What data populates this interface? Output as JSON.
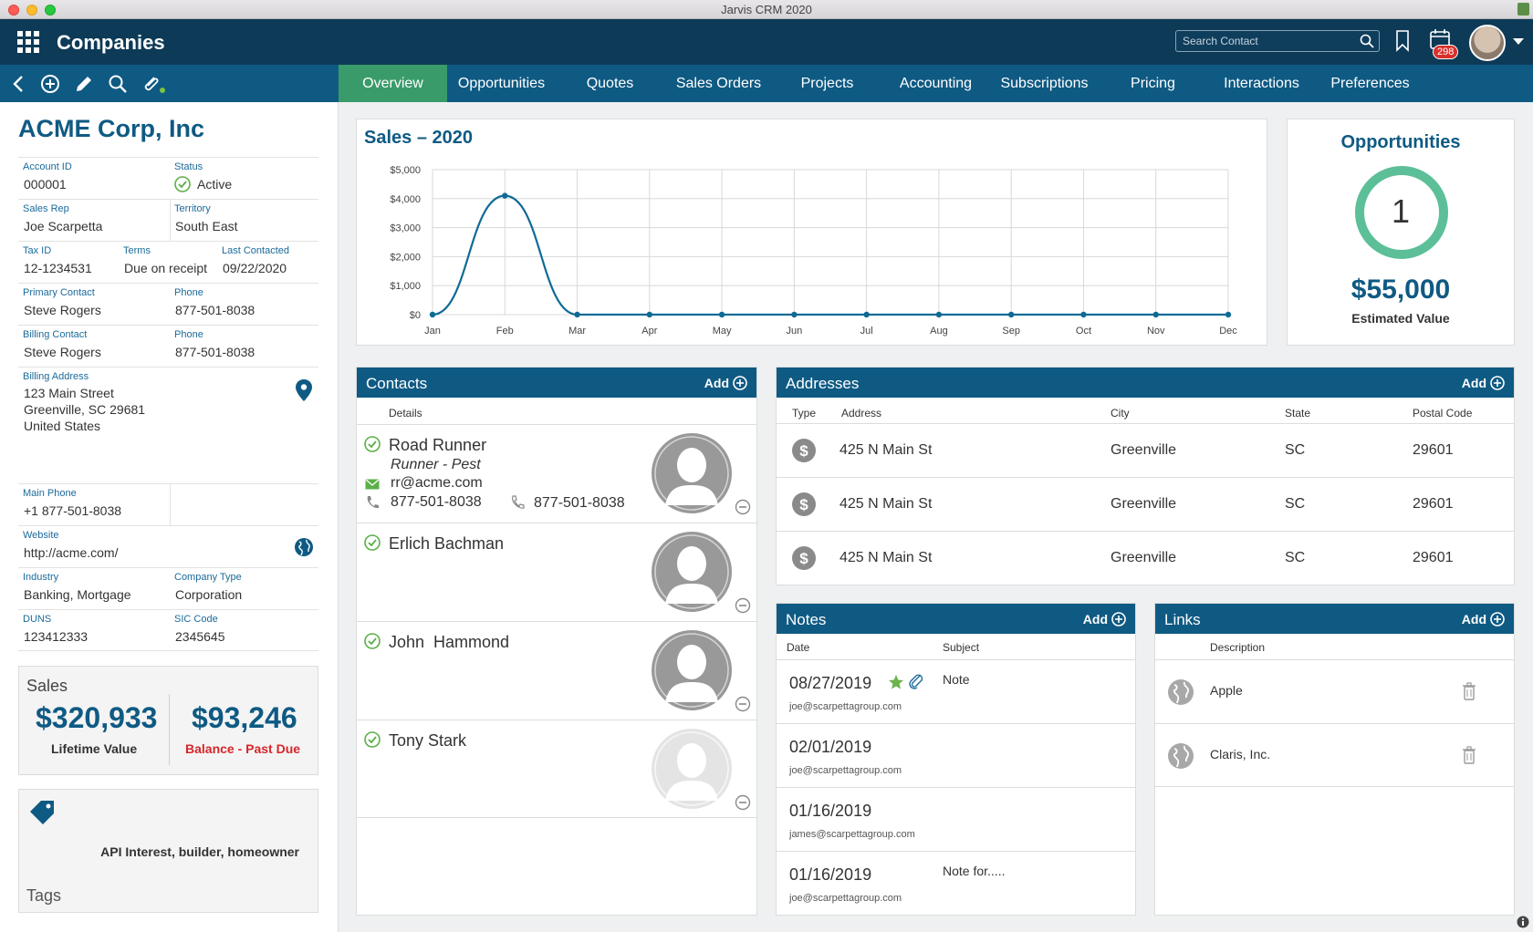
{
  "window": {
    "title": "Jarvis CRM 2020"
  },
  "header": {
    "title": "Companies",
    "search_placeholder": "Search Contact",
    "notification_count": "298"
  },
  "tabs": [
    "Overview",
    "Opportunities",
    "Quotes",
    "Sales Orders",
    "Projects",
    "Accounting",
    "Subscriptions",
    "Pricing",
    "Interactions",
    "Preferences"
  ],
  "company": {
    "name": "ACME Corp, Inc",
    "account_id_label": "Account ID",
    "account_id": "000001",
    "status_label": "Status",
    "status": "Active",
    "sales_rep_label": "Sales Rep",
    "sales_rep": "Joe Scarpetta",
    "territory_label": "Territory",
    "territory": "South East",
    "tax_id_label": "Tax ID",
    "tax_id": "12-1234531",
    "terms_label": "Terms",
    "terms": "Due on receipt",
    "last_contacted_label": "Last Contacted",
    "last_contacted": "09/22/2020",
    "primary_contact_label": "Primary Contact",
    "primary_contact": "Steve Rogers",
    "phone_label": "Phone",
    "primary_phone": "877-501-8038",
    "billing_contact_label": "Billing Contact",
    "billing_contact": "Steve Rogers",
    "billing_phone": "877-501-8038",
    "billing_address_label": "Billing Address",
    "address_line1": "123 Main Street",
    "address_line2": "Greenville, SC 29681",
    "address_line3": "United States",
    "main_phone_label": "Main Phone",
    "main_phone": "+1 877-501-8038",
    "website_label": "Website",
    "website": "http://acme.com/",
    "industry_label": "Industry",
    "industry": "Banking, Mortgage",
    "company_type_label": "Company Type",
    "company_type": "Corporation",
    "duns_label": "DUNS",
    "duns": "123412333",
    "sic_label": "SIC Code",
    "sic": "2345645"
  },
  "sales": {
    "title": "Sales",
    "lifetime_value": "$320,933",
    "lifetime_label": "Lifetime Value",
    "balance": "$93,246",
    "balance_label": "Balance - Past Due"
  },
  "tags": {
    "title": "Tags",
    "text": "API Interest, builder, homeowner"
  },
  "chart_data": {
    "type": "line",
    "title": "Sales – 2020",
    "categories": [
      "Jan",
      "Feb",
      "Mar",
      "Apr",
      "May",
      "Jun",
      "Jul",
      "Aug",
      "Sep",
      "Oct",
      "Nov",
      "Dec"
    ],
    "values": [
      0,
      4100,
      0,
      0,
      0,
      0,
      0,
      0,
      0,
      0,
      0,
      0
    ],
    "yticks": [
      "$0",
      "$1,000",
      "$2,000",
      "$3,000",
      "$4,000",
      "$5,000"
    ],
    "ylim": [
      0,
      5000
    ],
    "grid": true,
    "color": "#0f6a96"
  },
  "opportunities": {
    "title": "Opportunities",
    "count": "1",
    "value": "$55,000",
    "value_label": "Estimated Value",
    "ring_color": "#5cbf98"
  },
  "contacts": {
    "title": "Contacts",
    "add_label": "Add",
    "details_label": "Details",
    "items": [
      {
        "name": "Road Runner",
        "role": "Runner - Pest",
        "email": "rr@acme.com",
        "phone1": "877-501-8038",
        "phone2": "877-501-8038"
      },
      {
        "name": "Erlich Bachman"
      },
      {
        "name": "John  Hammond"
      },
      {
        "name": "Tony Stark"
      }
    ]
  },
  "addresses": {
    "title": "Addresses",
    "add_label": "Add",
    "columns": [
      "Type",
      "Address",
      "City",
      "State",
      "Postal Code"
    ],
    "rows": [
      {
        "address": "425 N Main St",
        "city": "Greenville",
        "state": "SC",
        "postal": "29601"
      },
      {
        "address": "425 N Main St",
        "city": "Greenville",
        "state": "SC",
        "postal": "29601"
      },
      {
        "address": "425 N Main St",
        "city": "Greenville",
        "state": "SC",
        "postal": "29601"
      }
    ]
  },
  "notes": {
    "title": "Notes",
    "add_label": "Add",
    "columns": [
      "Date",
      "Subject"
    ],
    "rows": [
      {
        "date": "08/27/2019",
        "email": "joe@scarpettagroup.com",
        "subject": "Note"
      },
      {
        "date": "02/01/2019",
        "email": "joe@scarpettagroup.com",
        "subject": ""
      },
      {
        "date": "01/16/2019",
        "email": "james@scarpettagroup.com",
        "subject": ""
      },
      {
        "date": "01/16/2019",
        "email": "joe@scarpettagroup.com",
        "subject": "Note for....."
      }
    ]
  },
  "links": {
    "title": "Links",
    "add_label": "Add",
    "column": "Description",
    "rows": [
      {
        "description": "Apple"
      },
      {
        "description": "Claris, Inc."
      }
    ]
  }
}
